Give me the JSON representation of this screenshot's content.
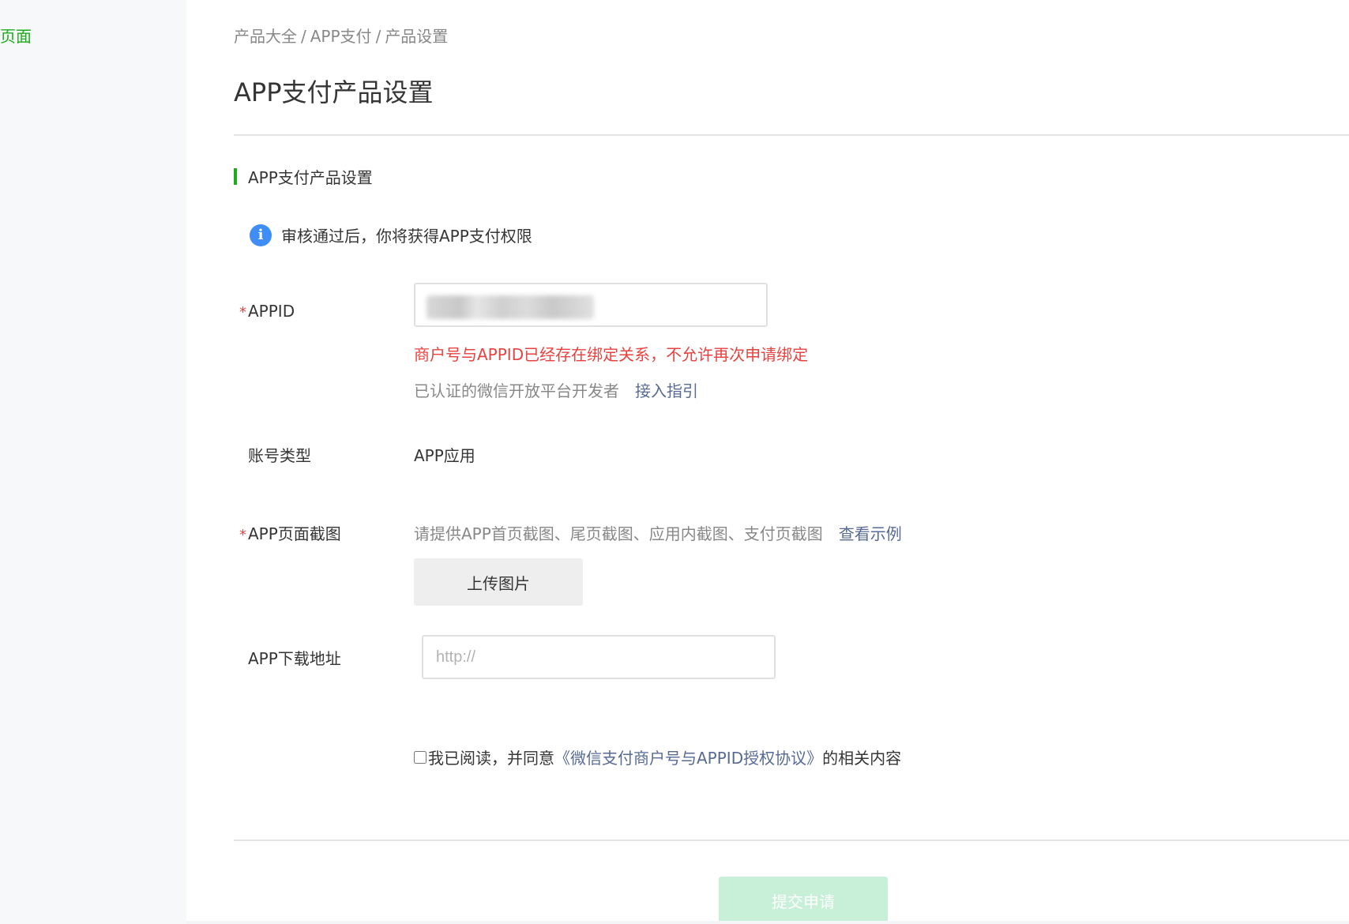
{
  "sidebar": {
    "active_item": "页面"
  },
  "breadcrumb": [
    "产品大全",
    "APP支付",
    "产品设置"
  ],
  "breadcrumb_separator": "/",
  "page_title": "APP支付产品设置",
  "section": {
    "title": "APP支付产品设置"
  },
  "notice": {
    "icon": "info-icon",
    "text": "审核通过后，你将获得APP支付权限"
  },
  "appid": {
    "label": "APPID",
    "required_mark": "*",
    "value": "",
    "error": "商户号与APPID已经存在绑定关系，不允许再次申请绑定",
    "help_text": "已认证的微信开放平台开发者",
    "help_link": "接入指引"
  },
  "account_type": {
    "label": "账号类型",
    "value": "APP应用"
  },
  "screenshot": {
    "label": "APP页面截图",
    "required_mark": "*",
    "hint": "请提供APP首页截图、尾页截图、应用内截图、支付页截图",
    "hint_link": "查看示例",
    "upload_label": "上传图片"
  },
  "download": {
    "label": "APP下载地址",
    "placeholder": "http://"
  },
  "agreement": {
    "checked": false,
    "prefix": "我已阅读，并同意",
    "link": "《微信支付商户号与APPID授权协议》",
    "suffix": "的相关内容"
  },
  "submit_label": "提交申请",
  "colors": {
    "accent": "#1aad19",
    "error": "#e64340",
    "link": "#576b95",
    "info": "#3f8ef7",
    "submit_disabled": "#c8f0d8"
  }
}
